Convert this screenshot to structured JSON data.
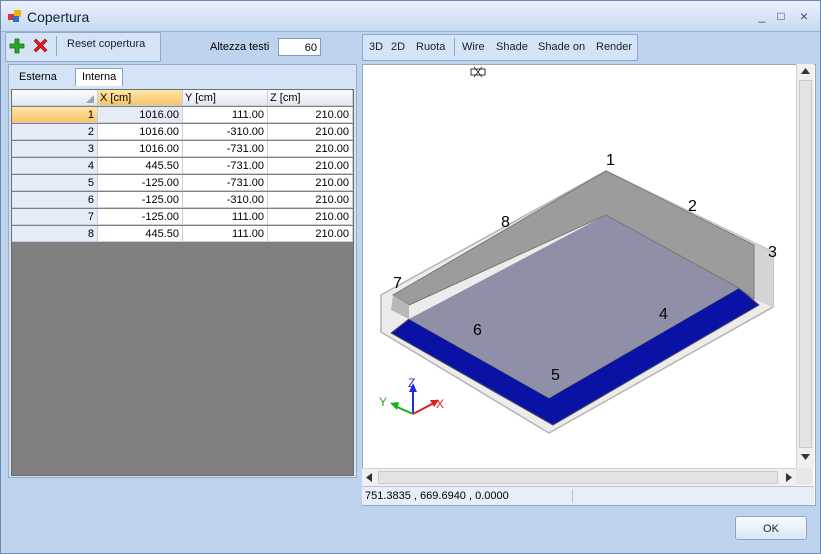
{
  "window": {
    "title": "Copertura",
    "controls": [
      "_",
      "□",
      "×"
    ]
  },
  "toolbar_left": {
    "reset_label": "Reset copertura",
    "altezza_label": "Altezza testi",
    "altezza_value": "60"
  },
  "toolbar_right": [
    "3D",
    "2D",
    "Ruota",
    "Wire",
    "Shade",
    "Shade on",
    "Render"
  ],
  "tabs": [
    "Esterna",
    "Interna"
  ],
  "table": {
    "columns": [
      "X [cm]",
      "Y [cm]",
      "Z [cm]"
    ],
    "rows": [
      [
        "1",
        "1016.00",
        "111.00",
        "210.00"
      ],
      [
        "2",
        "1016.00",
        "-310.00",
        "210.00"
      ],
      [
        "3",
        "1016.00",
        "-731.00",
        "210.00"
      ],
      [
        "4",
        "445.50",
        "-731.00",
        "210.00"
      ],
      [
        "5",
        "-125.00",
        "-731.00",
        "210.00"
      ],
      [
        "6",
        "-125.00",
        "-310.00",
        "210.00"
      ],
      [
        "7",
        "-125.00",
        "111.00",
        "210.00"
      ],
      [
        "8",
        "445.50",
        "111.00",
        "210.00"
      ]
    ]
  },
  "view": {
    "labels": [
      "1",
      "2",
      "3",
      "4",
      "5",
      "6",
      "7",
      "8"
    ],
    "axes": {
      "z": "Z",
      "y": "Y",
      "x": "X"
    },
    "colors": {
      "top": "#9c9c9c",
      "inner": "#8f8fa8",
      "blue": "#0a12a6",
      "outline": "#b4b4b4"
    }
  },
  "status": {
    "coords": "751.3835 , 669.6940 , 0.0000"
  },
  "ok_label": "OK"
}
